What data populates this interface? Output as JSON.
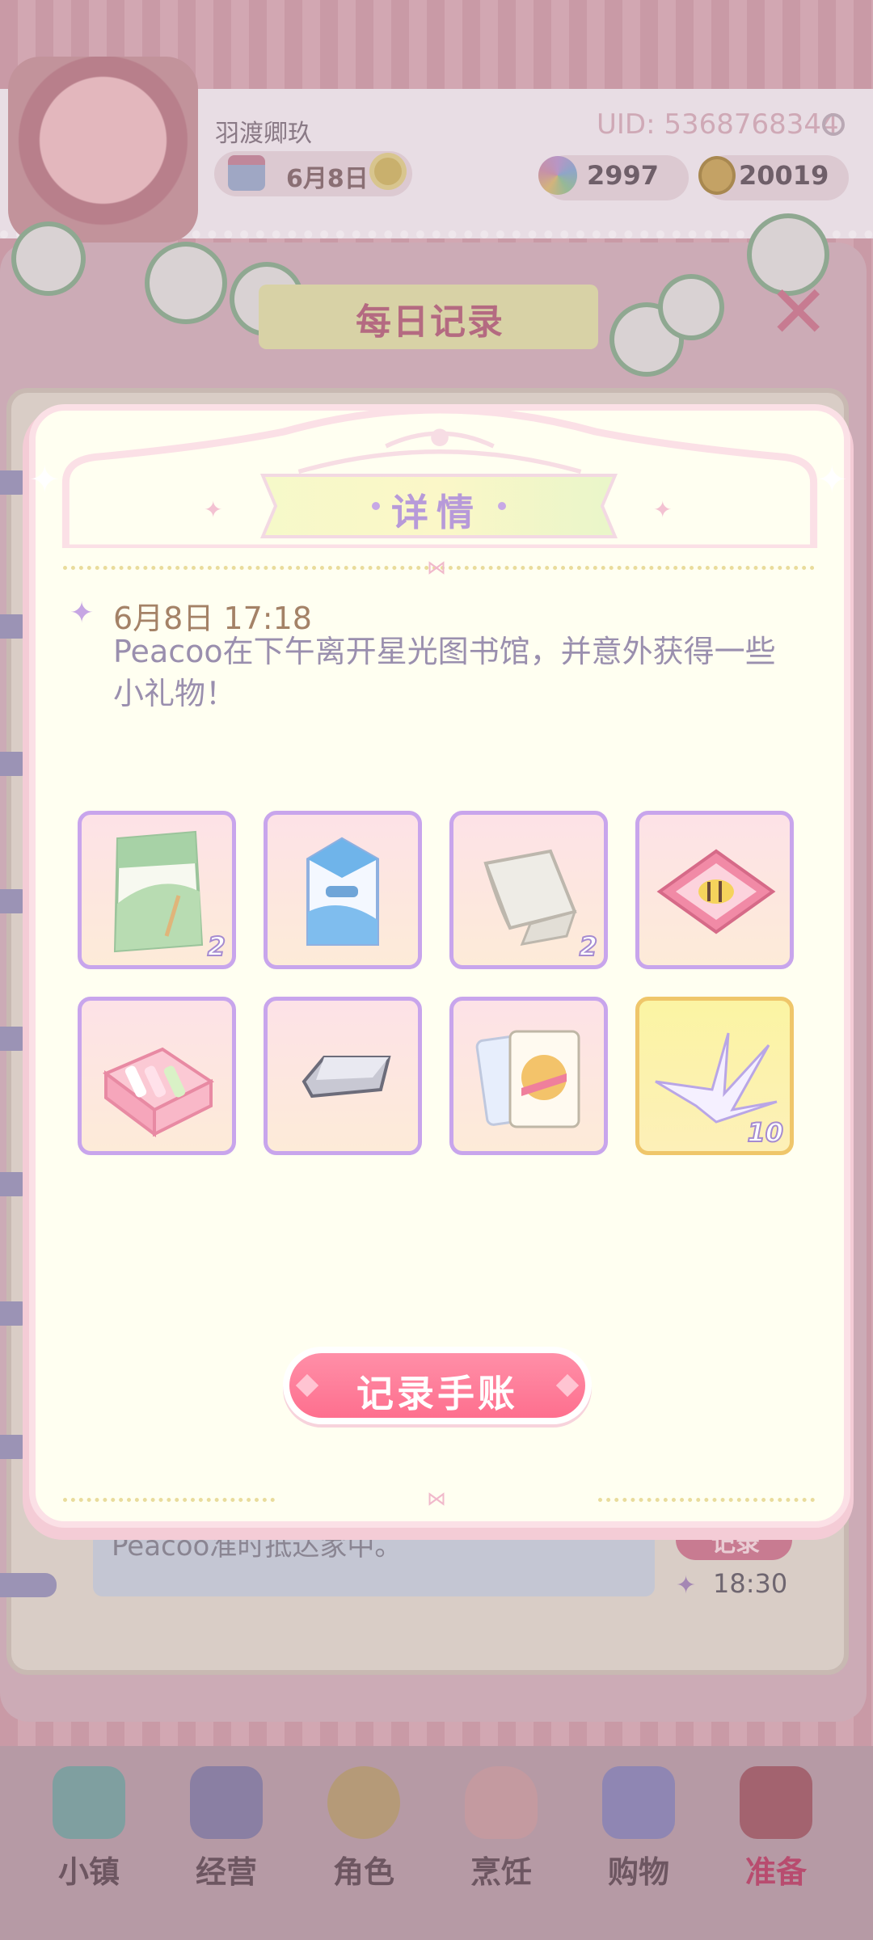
{
  "header": {
    "player_name": "羽渡卿玖",
    "uid": "UID: 5368768344",
    "date": "6月8日",
    "gems": "2997",
    "coins": "20019"
  },
  "panel": {
    "title": "每日记录",
    "background_record": {
      "text": "Peacoo准时抵达家中。",
      "button_label": "记录",
      "time": "18:30"
    }
  },
  "dialog": {
    "title": "详情",
    "entry": {
      "datetime": "6月8日 17:18",
      "description": "Peacoo在下午离开星光图书馆，并意外获得一些小礼物！"
    },
    "items": [
      {
        "icon": "flour-bag-icon",
        "qty": "2",
        "highlight": false
      },
      {
        "icon": "milk-carton-icon",
        "qty": "",
        "highlight": false
      },
      {
        "icon": "napkin-icon",
        "qty": "2",
        "highlight": false
      },
      {
        "icon": "bee-cushion-icon",
        "qty": "",
        "highlight": false
      },
      {
        "icon": "lipstick-box-icon",
        "qty": "",
        "highlight": false
      },
      {
        "icon": "silver-bar-icon",
        "qty": "",
        "highlight": false
      },
      {
        "icon": "playing-cards-icon",
        "qty": "",
        "highlight": false
      },
      {
        "icon": "paper-crane-icon",
        "qty": "10",
        "highlight": true
      }
    ],
    "button_label": "记录手账"
  },
  "nav": {
    "items": [
      {
        "label": "小镇",
        "icon": "map-icon"
      },
      {
        "label": "经营",
        "icon": "shop-bag-icon"
      },
      {
        "label": "角色",
        "icon": "character-icon"
      },
      {
        "label": "烹饪",
        "icon": "burger-icon"
      },
      {
        "label": "购物",
        "icon": "shopping-bag-icon"
      },
      {
        "label": "准备",
        "icon": "basket-icon"
      }
    ],
    "active": "准备"
  },
  "colors": {
    "accent_pink": "#fe6f8e",
    "title_purple": "#b79ad9",
    "slot_border": "#c8a5ec",
    "slot_border_gold": "#efc66a",
    "dialog_bg": "#fffff1"
  }
}
